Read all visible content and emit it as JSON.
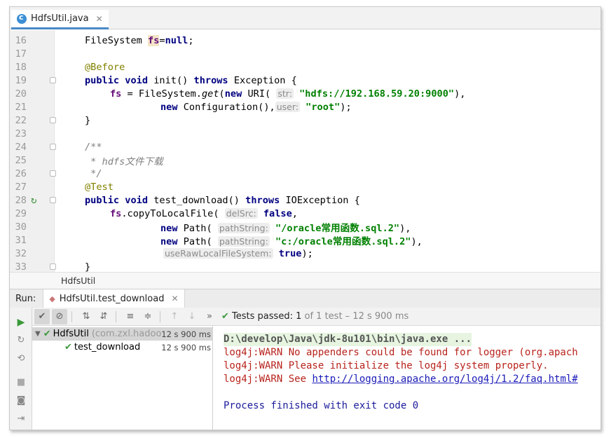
{
  "tab": {
    "label": "HdfsUtil.java",
    "icon": "java-class-icon"
  },
  "editor": {
    "lines": [
      {
        "n": "16"
      },
      {
        "n": "17"
      },
      {
        "n": "18"
      },
      {
        "n": "19"
      },
      {
        "n": "20"
      },
      {
        "n": "21"
      },
      {
        "n": "22"
      },
      {
        "n": "23"
      },
      {
        "n": "24"
      },
      {
        "n": "25"
      },
      {
        "n": "26"
      },
      {
        "n": "27"
      },
      {
        "n": "28"
      },
      {
        "n": "29"
      },
      {
        "n": "30"
      },
      {
        "n": "31"
      },
      {
        "n": "32"
      },
      {
        "n": "33"
      }
    ],
    "code": {
      "l16_a": "FileSystem ",
      "l16_fs": "fs",
      "l16_b": "=",
      "l16_null": "null",
      "l16_c": ";",
      "l18": "@Before",
      "l19_kw1": "public void ",
      "l19_a": "init() ",
      "l19_kw2": "throws ",
      "l19_b": "Exception {",
      "l20_fs": "fs",
      "l20_a": " = FileSystem.",
      "l20_get": "get",
      "l20_b": "(",
      "l20_new": "new ",
      "l20_c": "URI(",
      "l20_hint": "str:",
      "l20_str": "\"hdfs://192.168.59.20:9000\"",
      "l20_d": "),",
      "l21_new": "new ",
      "l21_a": "Configuration(),",
      "l21_hint": "user:",
      "l21_str": "\"root\"",
      "l21_b": ");",
      "l22": "}",
      "l24": "/**",
      "l25": " * hdfs文件下载",
      "l26": " */",
      "l27": "@Test",
      "l28_kw1": "public void ",
      "l28_a": "test_download() ",
      "l28_kw2": "throws ",
      "l28_b": "IOException {",
      "l29_fs": "fs",
      "l29_a": ".copyToLocalFile(",
      "l29_hint": "delSrc:",
      "l29_kw": "false",
      "l29_b": ",",
      "l30_new": "new ",
      "l30_a": "Path(",
      "l30_hint": "pathString:",
      "l30_str": "\"/oracle常用函数.sql.2\"",
      "l30_b": "),",
      "l31_new": "new ",
      "l31_a": "Path(",
      "l31_hint": "pathString:",
      "l31_str": "\"c:/oracle常用函数.sql.2\"",
      "l31_b": "),",
      "l32_hint": "useRawLocalFileSystem:",
      "l32_kw": "true",
      "l32_b": ");",
      "l33": "}"
    }
  },
  "breadcrumb": "HdfsUtil",
  "run": {
    "label": "Run:",
    "tab_label": "HdfsUtil.test_download",
    "status_prefix": "Tests passed:",
    "status_count": "1",
    "status_rest": "of 1 test – 12 s 900 ms"
  },
  "tree": {
    "root_label": "HdfsUtil",
    "root_pkg": "(com.zxl.hadoo",
    "root_time": "12 s 900 ms",
    "child_label": "test_download",
    "child_time": "12 s 900 ms"
  },
  "console": {
    "cmd": "D:\\develop\\Java\\jdk-8u101\\bin\\java.exe ...",
    "warn1": "log4j:WARN No appenders could be found for logger (org.apach",
    "warn2": "log4j:WARN Please initialize the log4j system properly.",
    "warn3_prefix": "log4j:WARN See ",
    "warn3_link": "http://logging.apache.org/log4j/1.2/faq.html#",
    "done": "Process finished with exit code 0"
  },
  "colors": {
    "keyword": "#000080",
    "string": "#008000",
    "annotation": "#808000",
    "comment": "#808080",
    "field": "#660e7a",
    "warn": "#b8231c",
    "link": "#1a1ab8",
    "pass": "#3f9a3f"
  }
}
